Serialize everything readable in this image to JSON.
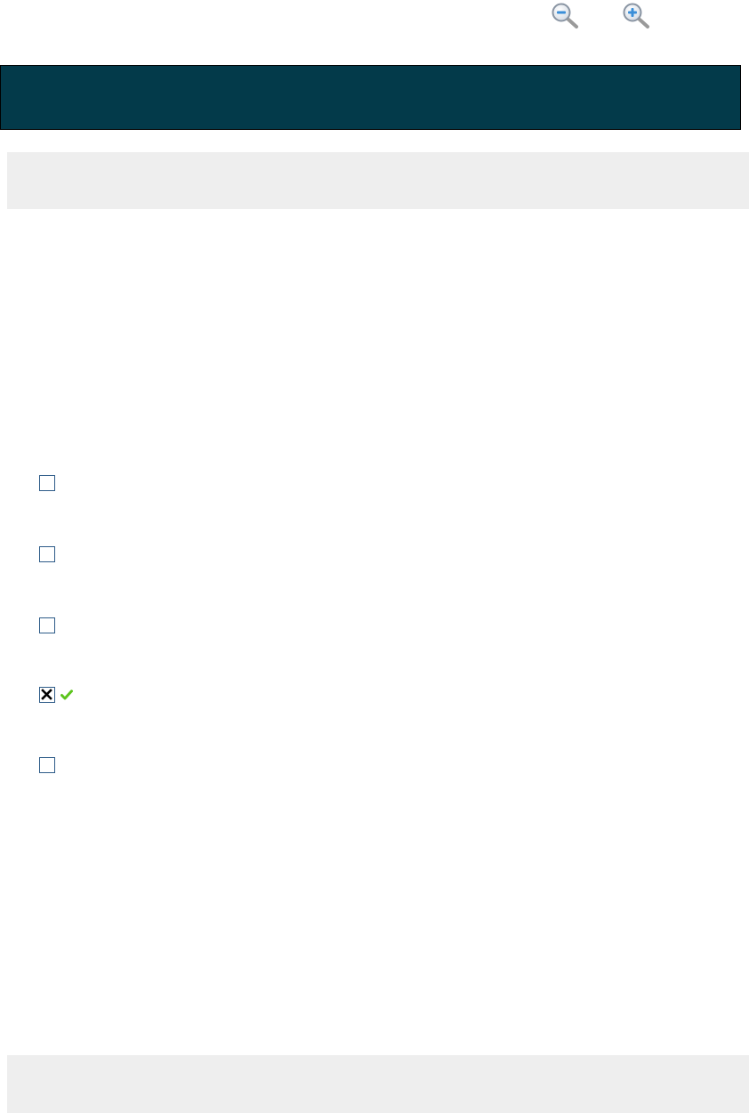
{
  "toolbar": {
    "zoom_out_icon": "zoom-out-magnifier-icon",
    "zoom_in_icon": "zoom-in-magnifier-icon"
  },
  "colors": {
    "header": "#033a4a",
    "panel": "#eeeeee",
    "checkbox_border": "#2d5b88",
    "correct_check": "#5cc41c"
  },
  "options": [
    {
      "checked": false,
      "correct": false
    },
    {
      "checked": false,
      "correct": false
    },
    {
      "checked": false,
      "correct": false
    },
    {
      "checked": true,
      "correct": true
    },
    {
      "checked": false,
      "correct": false
    }
  ]
}
